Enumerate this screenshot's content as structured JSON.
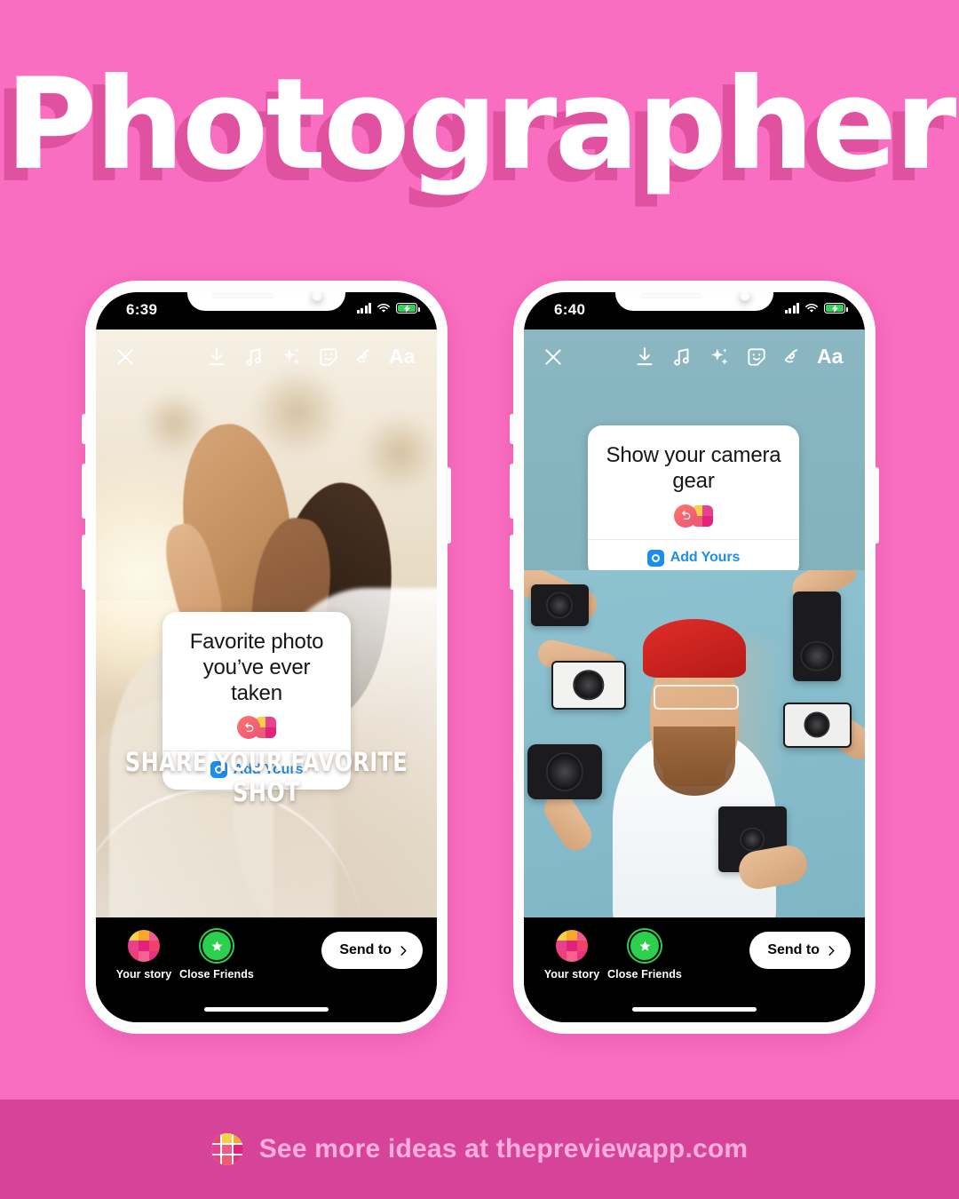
{
  "page": {
    "title": "Photographer",
    "background_color": "#fa6ec1",
    "title_color": "#ffffff",
    "title_shadow_color": "#e0529f"
  },
  "footer": {
    "text": "See more ideas at thepreviewapp.com",
    "logo_icon": "preview-grid-logo-icon",
    "background_color": "#d6449a",
    "text_color": "#ffaede"
  },
  "phones": [
    {
      "status": {
        "time": "6:39",
        "signal_icon": "cellular-bars-icon",
        "wifi_icon": "wifi-icon",
        "battery_icon": "battery-charging-icon"
      },
      "toolbar": [
        {
          "name": "close-icon",
          "label": "Close"
        },
        {
          "name": "download-icon",
          "label": "Save"
        },
        {
          "name": "music-icon",
          "label": "Music"
        },
        {
          "name": "sparkles-icon",
          "label": "Effects"
        },
        {
          "name": "sticker-icon",
          "label": "Stickers"
        },
        {
          "name": "draw-icon",
          "label": "Draw"
        },
        {
          "name": "text-aa-icon",
          "label": "Aa"
        }
      ],
      "sticker": {
        "prompt": "Favorite photo you’ve ever taken",
        "reply_icon": "reply-arrow-icon",
        "brand_icon": "preview-grid-logo-icon",
        "add_label": "Add Yours",
        "add_icon": "camera-badge-icon",
        "accent_color": "#1c8ef0"
      },
      "caption": "SHARE YOUR FAVORITE SHOT",
      "bottom": {
        "your_story_label": "Your story",
        "close_friends_label": "Close Friends",
        "send_label": "Send to",
        "send_icon": "chevron-right-icon",
        "story_avatar_icon": "preview-grid-avatar-icon",
        "close_friends_icon": "green-star-icon"
      }
    },
    {
      "status": {
        "time": "6:40",
        "signal_icon": "cellular-bars-icon",
        "wifi_icon": "wifi-icon",
        "battery_icon": "battery-charging-icon"
      },
      "toolbar": [
        {
          "name": "close-icon",
          "label": "Close"
        },
        {
          "name": "download-icon",
          "label": "Save"
        },
        {
          "name": "music-icon",
          "label": "Music"
        },
        {
          "name": "sparkles-icon",
          "label": "Effects"
        },
        {
          "name": "sticker-icon",
          "label": "Stickers"
        },
        {
          "name": "draw-icon",
          "label": "Draw"
        },
        {
          "name": "text-aa-icon",
          "label": "Aa"
        }
      ],
      "sticker": {
        "prompt": "Show your camera gear",
        "reply_icon": "reply-arrow-icon",
        "brand_icon": "preview-grid-logo-icon",
        "add_label": "Add Yours",
        "add_icon": "camera-badge-icon",
        "accent_color": "#1c8ef0"
      },
      "caption": "",
      "bottom": {
        "your_story_label": "Your story",
        "close_friends_label": "Close Friends",
        "send_label": "Send to",
        "send_icon": "chevron-right-icon",
        "story_avatar_icon": "preview-grid-avatar-icon",
        "close_friends_icon": "green-star-icon"
      }
    }
  ]
}
